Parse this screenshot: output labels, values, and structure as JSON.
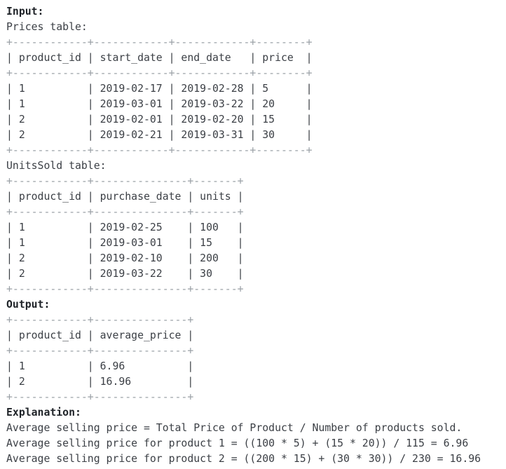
{
  "input_label": "Input:",
  "output_label": "Output:",
  "explanation_label": "Explanation:",
  "prices": {
    "caption": "Prices table:",
    "border": "+------------+------------+------------+--------+",
    "header": "| product_id | start_date | end_date   | price  |",
    "rows": [
      "| 1          | 2019-02-17 | 2019-02-28 | 5      |",
      "| 1          | 2019-03-01 | 2019-03-22 | 20     |",
      "| 2          | 2019-02-01 | 2019-02-20 | 15     |",
      "| 2          | 2019-02-21 | 2019-03-31 | 30     |"
    ]
  },
  "units_sold": {
    "caption": "UnitsSold table:",
    "border": "+------------+---------------+-------+",
    "header": "| product_id | purchase_date | units |",
    "rows": [
      "| 1          | 2019-02-25    | 100   |",
      "| 1          | 2019-03-01    | 15    |",
      "| 2          | 2019-02-10    | 200   |",
      "| 2          | 2019-03-22    | 30    |"
    ]
  },
  "output": {
    "border": "+------------+---------------+",
    "header": "| product_id | average_price |",
    "rows": [
      "| 1          | 6.96          |",
      "| 2          | 16.96         |"
    ]
  },
  "explanation": [
    "Average selling price = Total Price of Product / Number of products sold.",
    "Average selling price for product 1 = ((100 * 5) + (15 * 20)) / 115 = 6.96",
    "Average selling price for product 2 = ((200 * 15) + (30 * 30)) / 230 = 16.96"
  ]
}
